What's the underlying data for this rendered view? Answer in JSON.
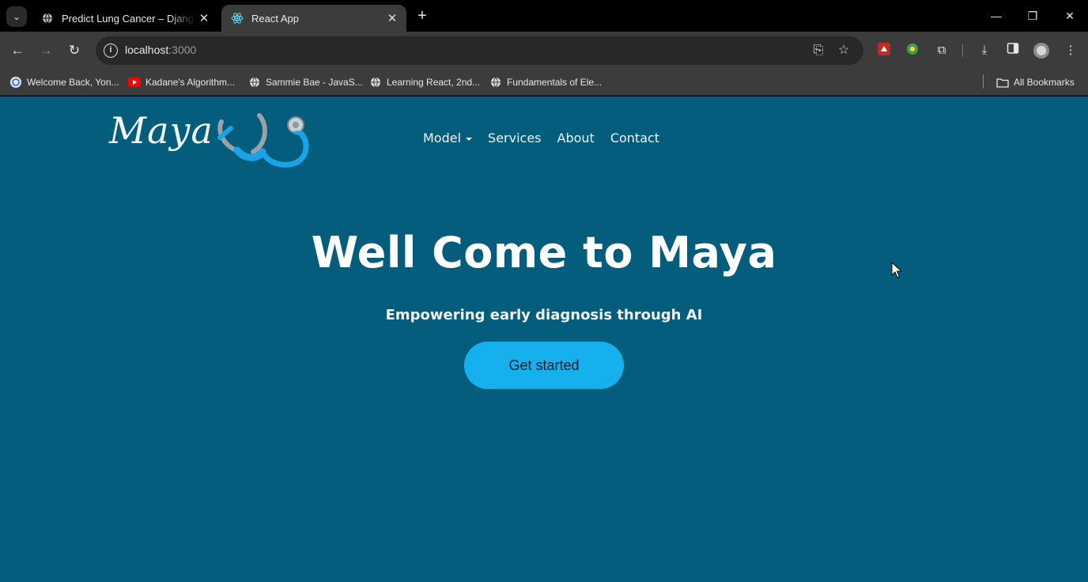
{
  "browser": {
    "tabs": [
      {
        "title": "Predict Lung Cancer – Django R",
        "active": false
      },
      {
        "title": "React App",
        "active": true
      }
    ],
    "url": {
      "host": "localhost",
      "port": ":3000"
    },
    "bookmarks": [
      {
        "label": "Welcome Back, Yon...",
        "icon": "site-icon"
      },
      {
        "label": "Kadane's Algorithm...",
        "icon": "youtube-icon"
      },
      {
        "label": "Sammie Bae - JavaS...",
        "icon": "globe-icon"
      },
      {
        "label": "Learning React, 2nd...",
        "icon": "globe-icon"
      },
      {
        "label": "Fundamentals of Ele...",
        "icon": "globe-icon"
      }
    ],
    "all_bookmarks_label": "All Bookmarks"
  },
  "site": {
    "logo_text": "Maya",
    "nav": [
      {
        "label": "Model",
        "dropdown": true
      },
      {
        "label": "Services"
      },
      {
        "label": "About"
      },
      {
        "label": "Contact"
      }
    ],
    "hero": {
      "title": "Well Come to Maya",
      "subtitle": "Empowering early diagnosis through AI",
      "cta_label": "Get started"
    }
  },
  "colors": {
    "page_bg": "#045d7c",
    "cta_bg": "#17b0ee",
    "stethoscope_blue": "#1ba3e8",
    "chrome_dark": "#000000",
    "chrome_toolbar": "#3c3c3c"
  }
}
